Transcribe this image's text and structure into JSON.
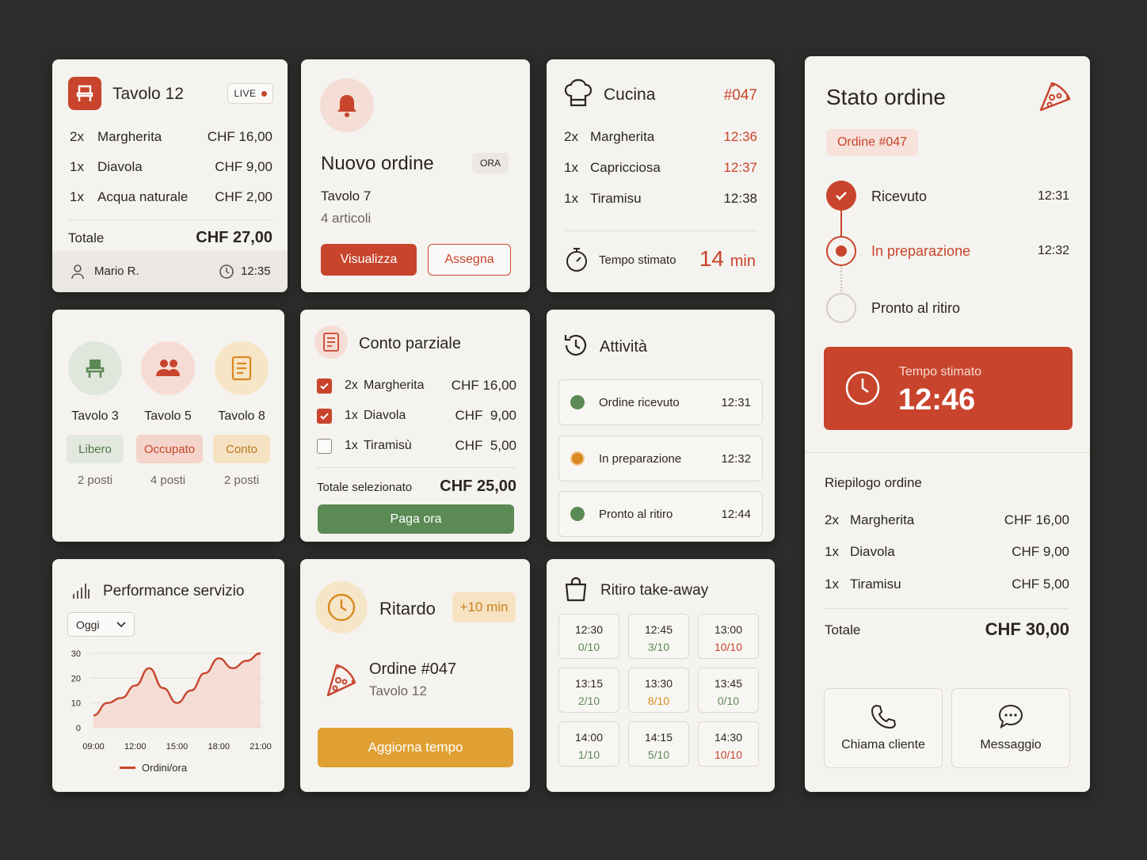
{
  "tavolo12": {
    "title": "Tavolo 12",
    "badge": "LIVE",
    "items": [
      {
        "qty": "2x",
        "name": "Margherita",
        "price": "CHF 16,00"
      },
      {
        "qty": "1x",
        "name": "Diavola",
        "price": "CHF 9,00"
      },
      {
        "qty": "1x",
        "name": "Acqua naturale",
        "price": "CHF 2,00"
      }
    ],
    "total_label": "Totale",
    "total_value": "CHF 27,00",
    "waiter": "Mario R.",
    "time": "12:35"
  },
  "nuovo_ordine": {
    "title": "Nuovo ordine",
    "badge": "ORA",
    "table": "Tavolo 7",
    "articles": "4 articoli",
    "view_label": "Visualizza",
    "assign_label": "Assegna"
  },
  "cucina": {
    "title": "Cucina",
    "order_no": "#047",
    "items": [
      {
        "qty": "2x",
        "name": "Margherita",
        "time": "12:36",
        "late": true
      },
      {
        "qty": "1x",
        "name": "Capricciosa",
        "time": "12:37",
        "late": true
      },
      {
        "qty": "1x",
        "name": "Tiramisu",
        "time": "12:38",
        "late": false
      }
    ],
    "estimate_label": "Tempo stimato",
    "estimate_value": "14",
    "estimate_unit": "min"
  },
  "stato": {
    "title": "Stato ordine",
    "order_badge": "Ordine #047",
    "steps": [
      {
        "label": "Ricevuto",
        "time": "12:31",
        "state": "done"
      },
      {
        "label": "In preparazione",
        "time": "12:32",
        "state": "active"
      },
      {
        "label": "Pronto al ritiro",
        "time": "",
        "state": "pending"
      }
    ],
    "estimate_label": "Tempo stimato",
    "estimate_value": "12:46",
    "summary_title": "Riepilogo ordine",
    "items": [
      {
        "qty": "2x",
        "name": "Margherita",
        "price": "CHF 16,00"
      },
      {
        "qty": "1x",
        "name": "Diavola",
        "price": "CHF 9,00"
      },
      {
        "qty": "1x",
        "name": "Tiramisu",
        "price": "CHF 5,00"
      }
    ],
    "total_label": "Totale",
    "total_value": "CHF 30,00",
    "call_label": "Chiama cliente",
    "message_label": "Messaggio"
  },
  "tavoli": [
    {
      "name": "Tavolo 3",
      "status": "Libero",
      "seats": "2 posti"
    },
    {
      "name": "Tavolo 5",
      "status": "Occupato",
      "seats": "4 posti"
    },
    {
      "name": "Tavolo 8",
      "status": "Conto",
      "seats": "2 posti"
    }
  ],
  "conto": {
    "title": "Conto parziale",
    "items": [
      {
        "qty": "2x",
        "name": "Margherita",
        "price": "CHF 16,00",
        "checked": true
      },
      {
        "qty": "1x",
        "name": "Diavola",
        "price": "CHF  9,00",
        "checked": true
      },
      {
        "qty": "1x",
        "name": "Tiramisù",
        "price": "CHF  5,00",
        "checked": false
      }
    ],
    "total_label": "Totale selezionato",
    "total_value": "CHF 25,00",
    "pay_label": "Paga ora"
  },
  "attivita": {
    "title": "Attività",
    "rows": [
      {
        "label": "Ordine ricevuto",
        "time": "12:31",
        "color": "#5b8a55"
      },
      {
        "label": "In preparazione",
        "time": "12:32",
        "color": "#d9891f"
      },
      {
        "label": "Pronto al ritiro",
        "time": "12:44",
        "color": "#5b8a55"
      }
    ]
  },
  "performance": {
    "title": "Performance servizio",
    "period": "Oggi",
    "legend": "Ordini/ora"
  },
  "chart_data": {
    "type": "area",
    "x": [
      "09:00",
      "12:00",
      "15:00",
      "18:00",
      "21:00"
    ],
    "x_numeric": [
      9,
      10,
      11,
      12,
      13,
      14,
      15,
      16,
      17,
      18,
      19,
      20,
      21
    ],
    "values": [
      5,
      10,
      12,
      17,
      24,
      16,
      10,
      15,
      22,
      28,
      24,
      27,
      30
    ],
    "yticks": [
      0,
      10,
      20,
      30
    ],
    "ylim": [
      0,
      30
    ],
    "series_name": "Ordini/ora",
    "color": "#c8442c"
  },
  "ritardo": {
    "title": "Ritardo",
    "badge": "+10 min",
    "order": "Ordine #047",
    "table": "Tavolo 12",
    "update_label": "Aggiorna tempo"
  },
  "takeaway": {
    "title": "Ritiro take-away",
    "slots": [
      {
        "time": "12:30",
        "count": "0/10",
        "state": "ok"
      },
      {
        "time": "12:45",
        "count": "3/10",
        "state": "ok"
      },
      {
        "time": "13:00",
        "count": "10/10",
        "state": "full"
      },
      {
        "time": "13:15",
        "count": "2/10",
        "state": "ok"
      },
      {
        "time": "13:30",
        "count": "8/10",
        "state": "warn"
      },
      {
        "time": "13:45",
        "count": "0/10",
        "state": "ok"
      },
      {
        "time": "14:00",
        "count": "1/10",
        "state": "ok"
      },
      {
        "time": "14:15",
        "count": "5/10",
        "state": "ok"
      },
      {
        "time": "14:30",
        "count": "10/10",
        "state": "full"
      }
    ]
  },
  "colors": {
    "accent": "#c8442c",
    "green": "#5b8a55",
    "amber": "#e0a033",
    "orange": "#d9891f"
  }
}
